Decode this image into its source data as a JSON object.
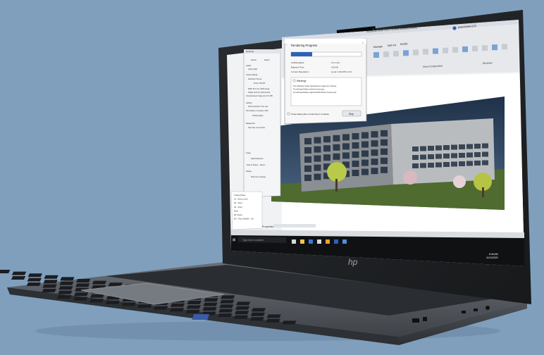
{
  "colors": {
    "background": "#7f9fbd",
    "laptop_body": "#5c6168",
    "bezel": "#121416",
    "progress_fill": "#2f5fb8",
    "taskbar": "#0f1113",
    "sky": "#243a52",
    "grass": "#4f6b2f"
  },
  "progress": {
    "fraction": 0.3
  },
  "dialog": {
    "title": "Rendering Progress",
    "percent": "30 %",
    "rows": [
      {
        "label": "Artificial lights:",
        "value": "0 of 2 (0)"
      },
      {
        "label": "Elapsed Time:",
        "value": "0:00:00"
      },
      {
        "label": "Current Resolution:",
        "value": "Level 1 (64 DPI) of 10"
      }
    ],
    "warnings_label": "Warnings",
    "warning_lines": [
      "The following render appearance images are missing:",
      "Furnishings/Gallery.exterior.lumps.png",
      "Furnishings/Gallery.Lighter.Marble Brown.Sumps.png"
    ],
    "close_label": "Close dialog when rendering is complete",
    "stop_label": "Stop"
  },
  "render_panel": {
    "title": "Rendering",
    "render_button": "Render",
    "region_label": "Region",
    "quality_label": "Quality",
    "setting_label": "Setting",
    "setting_value": "High",
    "output_label": "Output Settings",
    "resolution_label": "Resolution",
    "screen_label": "Screen",
    "printer_label": "Printer",
    "dpi_value": "150 DPI",
    "width_label": "Width",
    "width_value": "25.0 mm (1200 pixels)",
    "height_label": "Height",
    "height_value": "13.8 mm (1010 pixels)",
    "size_label": "Uncompressed image size",
    "size_value": "10.1 MB",
    "lighting_label": "Lighting",
    "scheme_label": "Scheme",
    "scheme_value": "Exterior: Sun only",
    "sun_label": "Sun Setting",
    "sun_value": "<In-session, Still>",
    "artificial_button": "Artificial Lights...",
    "background_label": "Background",
    "style_label": "Style",
    "style_value": "Sky: Few Clouds",
    "image_label": "Image",
    "adjust_button": "Adjust Exposure...",
    "save_button": "Save to Project...",
    "export_button": "Export...",
    "display_label": "Display",
    "show_button": "Show the rendering"
  },
  "browser_tree": [
    "Ceiling Plans",
    "01 - Entry Level",
    "02 - Floor",
    "03 - Floor",
    "Roof",
    "3D Views",
    "3D - Floor Middle - Ver"
  ],
  "properties_label": "Properties",
  "ribbon": {
    "title": "Autodesk Revit 2021 - [Office Building Model]",
    "user": "jeanclimber123",
    "tabs": [
      "Manage",
      "Add-Ins",
      "Modify"
    ],
    "groups": [
      "Show Composition",
      "Windows"
    ]
  },
  "taskbar": {
    "search_placeholder": "Type here to search",
    "time": "8:46 AM",
    "date": "11/11/2020"
  },
  "laptop": {
    "brand": "hp"
  }
}
